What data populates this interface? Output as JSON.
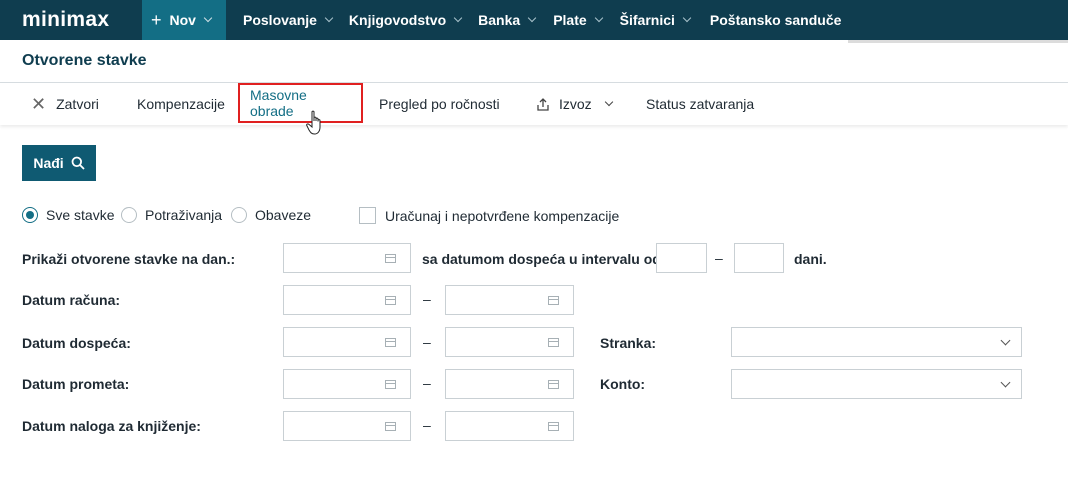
{
  "nav": {
    "logo": "minimax",
    "new_label": "Nov",
    "items": [
      {
        "label": "Poslovanje"
      },
      {
        "label": "Knjigovodstvo"
      },
      {
        "label": "Banka"
      },
      {
        "label": "Plate"
      },
      {
        "label": "Šifarnici"
      },
      {
        "label": "Poštansko sanduče"
      }
    ]
  },
  "page": {
    "title": "Otvorene stavke"
  },
  "toolbar": {
    "close": "Zatvori",
    "compensation": "Kompenzacije",
    "mass": "Masovne obrade",
    "maturity": "Pregled po ročnosti",
    "export": "Izvoz",
    "status": "Status zatvaranja"
  },
  "search": {
    "button": "Nađi"
  },
  "filters": {
    "radio_all": "Sve stavke",
    "radio_receivables": "Potraživanja",
    "radio_liabilities": "Obaveze",
    "include_unconfirmed": "Uračunaj i nepotvrđene kompenzacije",
    "show_on_date": "Prikaži otvorene stavke na dan.:",
    "due_interval": "sa datumom dospeća u intervalu od",
    "days": "dani.",
    "invoice_date": "Datum računa:",
    "due_date": "Datum dospeća:",
    "turnover_date": "Datum prometa:",
    "posting_date": "Datum naloga za knjiženje:",
    "partner": "Stranka:",
    "account": "Konto:",
    "dash": "–"
  },
  "colors": {
    "nav_bg": "#0f3d4f",
    "accent": "#136e85",
    "highlight": "#e02020"
  }
}
